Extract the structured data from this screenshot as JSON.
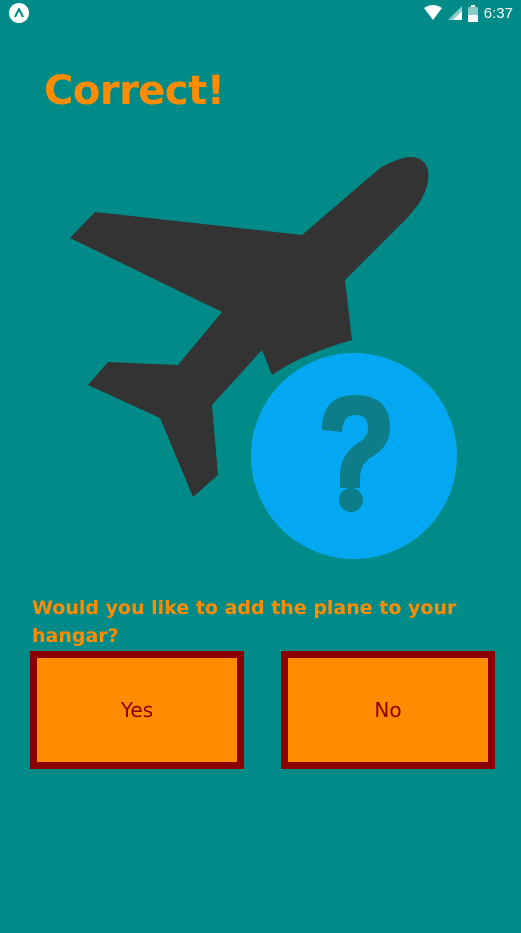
{
  "status_bar": {
    "time": "6:37",
    "icons": [
      "app-logo-icon",
      "wifi-icon",
      "signal-icon",
      "battery-icon"
    ]
  },
  "result": {
    "title": "Correct!"
  },
  "illustration": {
    "icons": [
      "airplane-icon",
      "question-mark-icon"
    ]
  },
  "prompt": {
    "question": "Would you like to add the plane to your hangar?"
  },
  "buttons": {
    "yes_label": "Yes",
    "no_label": "No"
  },
  "colors": {
    "background": "#008b88",
    "accent": "#ff8c00",
    "button_border": "#8b0000",
    "airplane": "#333333",
    "question_circle": "#03a9f4"
  }
}
